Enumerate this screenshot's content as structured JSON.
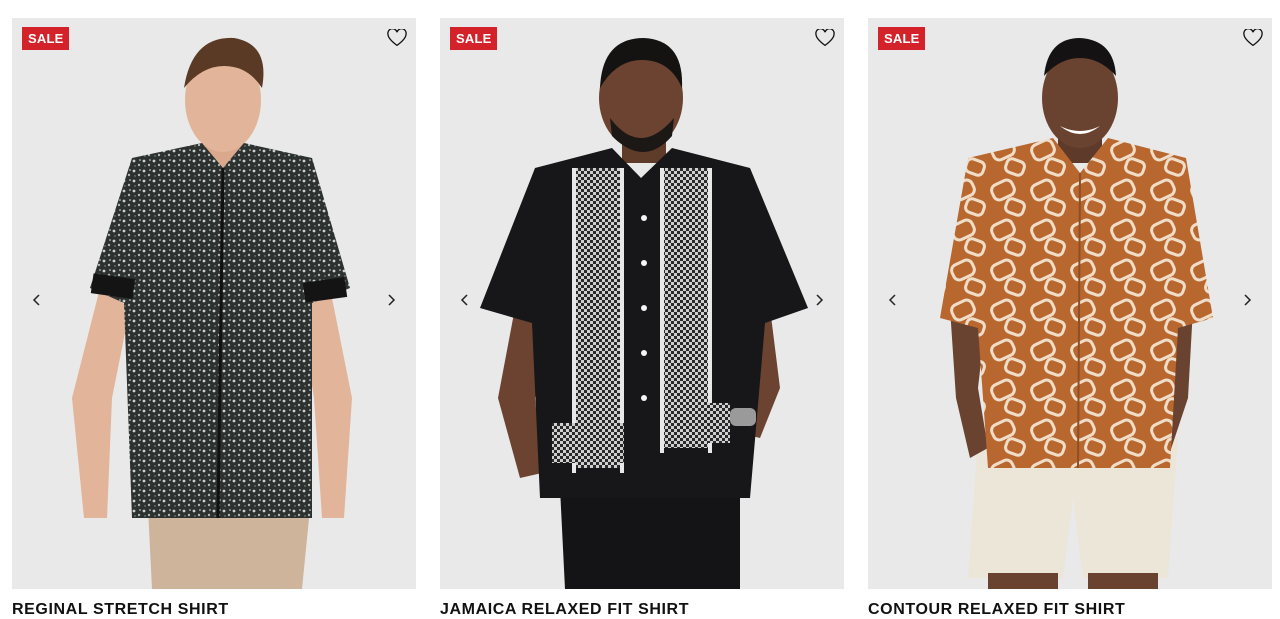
{
  "products": [
    {
      "badge": "SALE",
      "title": "REGINAL STRETCH SHIRT",
      "image_alt": "Man in black floral print short sleeve shirt and beige trousers",
      "wishlist_icon": "heart-outline-icon",
      "prev_icon": "chevron-left-icon",
      "next_icon": "chevron-right-icon",
      "colors": {
        "shirt": "#2d3230",
        "pattern": "#c9d2cc",
        "pants": "#cdb49a",
        "skin": "#e2b49a"
      }
    },
    {
      "badge": "SALE",
      "title": "JAMAICA RELAXED FIT SHIRT",
      "image_alt": "Man in black camp collar shirt with white geometric panels",
      "wishlist_icon": "heart-outline-icon",
      "prev_icon": "chevron-left-icon",
      "next_icon": "chevron-right-icon",
      "colors": {
        "shirt": "#17171a",
        "pattern": "#d8d8d8",
        "pants": "#141416",
        "skin": "#6b4330"
      }
    },
    {
      "badge": "SALE",
      "title": "CONTOUR RELAXED FIT SHIRT",
      "image_alt": "Man in rust and cream abstract print camp shirt and cream shorts",
      "wishlist_icon": "heart-outline-icon",
      "prev_icon": "chevron-left-icon",
      "next_icon": "chevron-right-icon",
      "colors": {
        "shirt": "#b8672f",
        "pattern": "#f0ddc8",
        "pants": "#ece6d8",
        "skin": "#6a4330"
      }
    }
  ],
  "accent_color": "#d3222a"
}
